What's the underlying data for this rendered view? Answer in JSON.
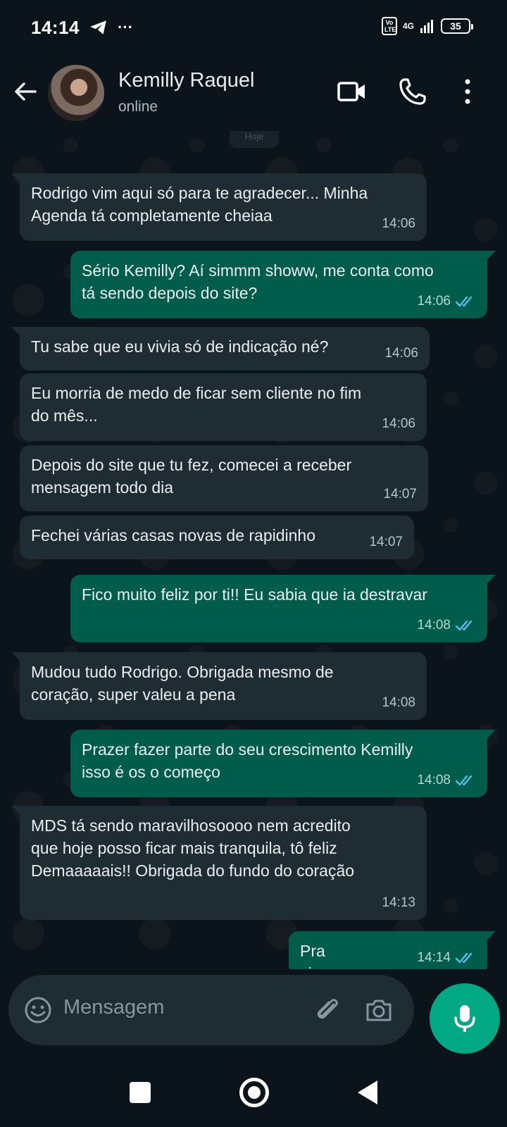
{
  "status_bar": {
    "time": "14:14",
    "more": "···",
    "volte": "Vo LTE",
    "network": "4G",
    "battery": "35"
  },
  "header": {
    "contact_name": "Kemilly Raquel",
    "contact_status": "online"
  },
  "date_chip": "Hoje",
  "messages": [
    {
      "direction": "in",
      "text": "Rodrigo vim aqui só para te agradecer... Minha\nAgenda tá completamente cheiaa",
      "time": "14:06"
    },
    {
      "direction": "out",
      "text": "Sério Kemilly? Aí simmm showw, me conta como\ntá sendo depois do site?",
      "time": "14:06",
      "status": "read"
    },
    {
      "direction": "in",
      "text": "Tu sabe que eu vivia só de indicação né?",
      "time": "14:06"
    },
    {
      "direction": "in",
      "text": "Eu morria de medo de ficar sem cliente no fim\ndo mês...",
      "time": "14:06"
    },
    {
      "direction": "in",
      "text": "Depois do site que tu fez, comecei a receber\nmensagem todo dia",
      "time": "14:07"
    },
    {
      "direction": "in",
      "text": "Fechei várias casas novas de rapidinho",
      "time": "14:07"
    },
    {
      "direction": "out",
      "text": "Fico muito feliz por ti!! Eu sabia que ia destravar",
      "time": "14:08",
      "status": "read"
    },
    {
      "direction": "in",
      "text": "Mudou tudo Rodrigo. Obrigada mesmo de\ncoração, super valeu a pena",
      "time": "14:08"
    },
    {
      "direction": "out",
      "text": "Prazer fazer parte do seu crescimento Kemilly\nisso é os o começo",
      "time": "14:08",
      "status": "read"
    },
    {
      "direction": "in",
      "text": "MDS tá sendo maravilhosoooo nem acredito\nque hoje posso ficar mais tranquila, tô feliz\nDemaaaaais!! Obrigada do fundo do coração",
      "time": "14:13"
    },
    {
      "direction": "out",
      "text": "Pra cimaaaaa",
      "time": "14:14",
      "status": "read"
    }
  ],
  "composer": {
    "placeholder": "Mensagem"
  },
  "colors": {
    "background": "#0b141a",
    "incoming_bubble": "#202c33",
    "outgoing_bubble": "#005c4b",
    "accent": "#00a884",
    "read_ticks": "#53bdeb"
  },
  "icons": [
    "back-arrow-icon",
    "video-call-icon",
    "voice-call-icon",
    "more-options-icon",
    "emoji-icon",
    "attach-icon",
    "camera-icon",
    "microphone-icon"
  ]
}
